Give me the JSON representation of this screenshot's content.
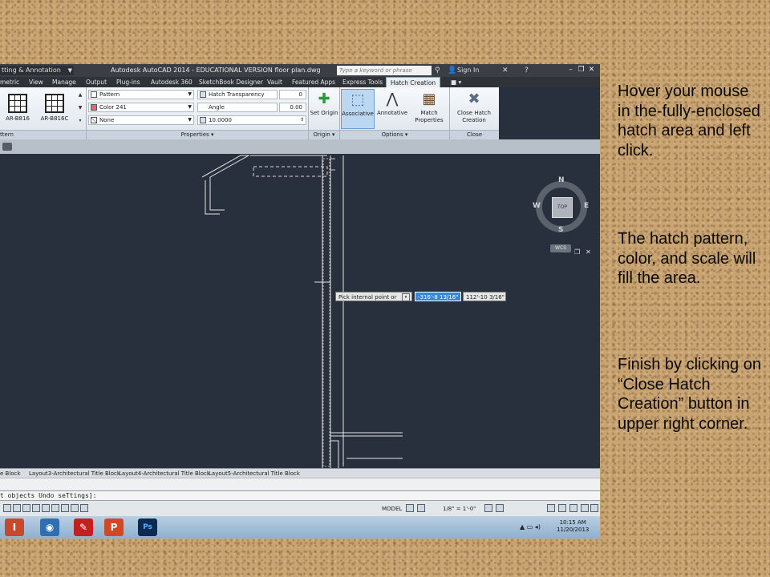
{
  "titlebar": {
    "workspace": "tting & Annotation",
    "app_title": "Autodesk AutoCAD 2014 - EDUCATIONAL VERSION   floor plan.dwg",
    "search_placeholder": "Type a keyword or phrase",
    "sign_in": "Sign In"
  },
  "tabs": [
    "metric",
    "View",
    "Manage",
    "Output",
    "Plug-ins",
    "Autodesk 360",
    "SketchBook Designer",
    "Vault",
    "Featured Apps",
    "Express Tools",
    "Hatch Creation"
  ],
  "ribbon": {
    "patterns": [
      "AR-B816",
      "AR-B816C"
    ],
    "pattern_panel_label": "ttern",
    "type": "Pattern",
    "color": "Color 241",
    "background": "None",
    "transparency_label": "Hatch Transparency",
    "transparency_value": "0",
    "angle_label": "Angle",
    "angle_value": "0.00",
    "scale_value": "10.0000",
    "properties_label": "Properties ▾",
    "set_origin": "Set Origin",
    "origin_label": "Origin ▾",
    "associative": "Associative",
    "annotative": "Annotative",
    "match_properties": "Match Properties",
    "options_label": "Options ▾",
    "close_hatch": "Close Hatch Creation",
    "close_label": "Close"
  },
  "viewcube": {
    "n": "N",
    "s": "S",
    "e": "E",
    "w": "W",
    "top": "TOP",
    "wcs": "WCS"
  },
  "tooltip": {
    "prompt": "Pick internal point or",
    "x": "-316'-8 13/16\"",
    "y": "112'-10 3/16\""
  },
  "layout_tabs": [
    "e Block",
    "Layout3-Architectural Title Block",
    "Layout4-Architectural Title Block",
    "Layout5-Architectural Title Block"
  ],
  "command_line": "t objects Undo seTtings]:",
  "status": {
    "model": "MODEL",
    "scale": "1/8\" = 1'-0\""
  },
  "taskbar": {
    "time": "10:15 AM",
    "date": "11/20/2013"
  },
  "notes": {
    "step1": "Hover your mouse in the-fully-enclosed hatch area and left click.",
    "step2": "The hatch pattern, color, and scale will fill the area.",
    "step3": "Finish by clicking on “Close Hatch Creation” button in upper right corner."
  },
  "colors": {
    "hatch_color_swatch": "#e8647a",
    "canvas": "#27303c",
    "cork": "#c9a473"
  }
}
